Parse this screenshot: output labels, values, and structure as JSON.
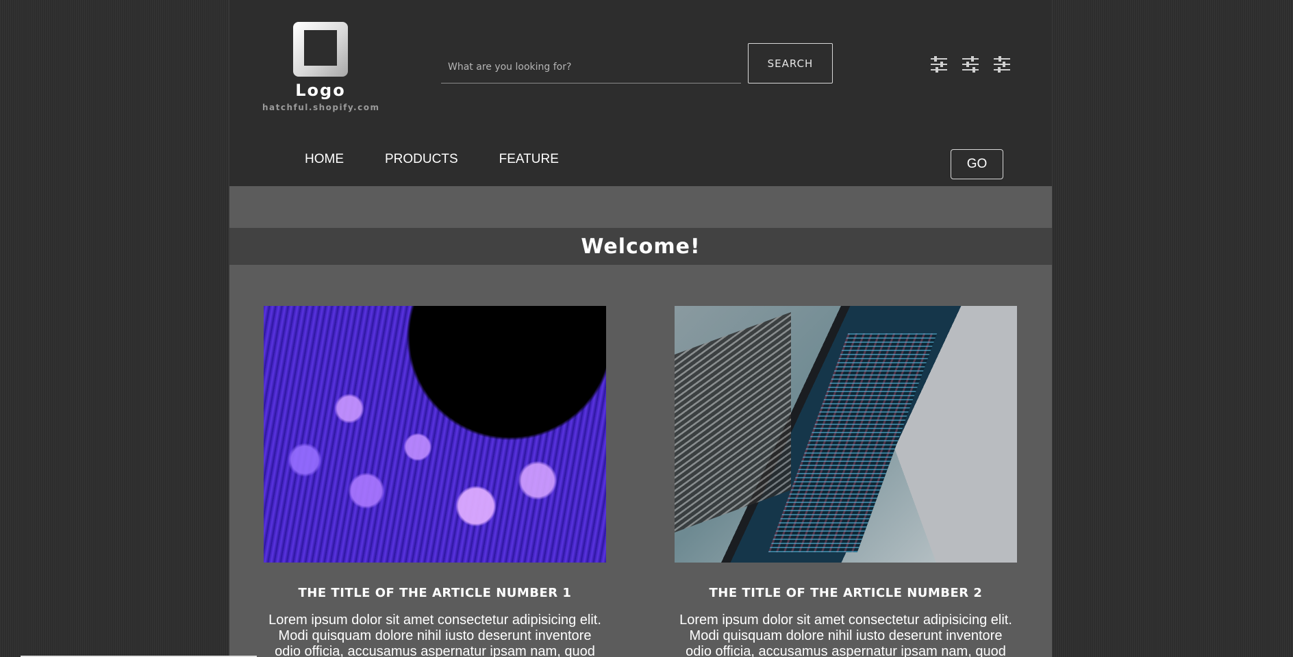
{
  "logo": {
    "text": "Logo",
    "subtitle": "hatchful.shopify.com",
    "icon": "square-frame-logo-icon"
  },
  "search": {
    "placeholder": "What are you looking for?",
    "value": "",
    "button_label": "SEARCH"
  },
  "filters": {
    "icons": [
      "sliders-icon",
      "sliders-icon",
      "sliders-icon"
    ]
  },
  "nav": {
    "items": [
      {
        "label": "HOME"
      },
      {
        "label": "PRODUCTS"
      },
      {
        "label": "FEATURE"
      }
    ],
    "go_label": "GO"
  },
  "welcome": {
    "title": "Welcome!"
  },
  "articles": [
    {
      "title": "THE TITLE OF THE ARTICLE NUMBER 1",
      "body": "Lorem ipsum dolor sit amet consectetur adipisicing elit. Modi quisquam dolore nihil iusto deserunt inventore odio officia, accusamus aspernatur ipsam nam, quod illum.",
      "image": "fiber-optic-photo"
    },
    {
      "title": "THE TITLE OF THE ARTICLE NUMBER 2",
      "body": "Lorem ipsum dolor sit amet consectetur adipisicing elit. Modi quisquam dolore nihil iusto deserunt inventore odio officia, accusamus aspernatur ipsam nam, quod illum.",
      "image": "laptop-code-photo"
    }
  ],
  "colors": {
    "header_bg": "#2d2d2d",
    "content_bg": "#5c5c5c",
    "welcome_bar_bg": "#424242",
    "text": "#ffffff"
  }
}
